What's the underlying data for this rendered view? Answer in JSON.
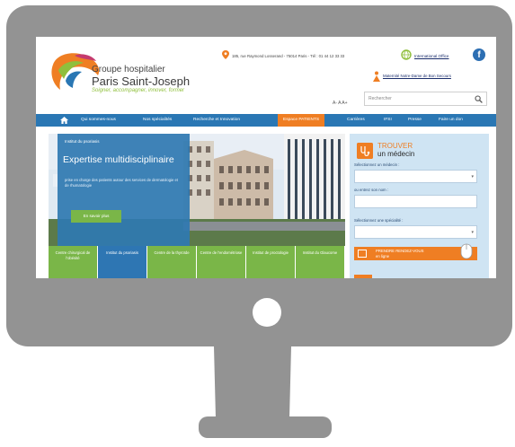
{
  "header": {
    "logo_line1": "Groupe hospitalier",
    "logo_line2": "Paris Saint-Joseph",
    "logo_tagline": "Soigner, accompagner, innover, former",
    "address": "185, rue Raymond Losserand - 75014 Paris - Tél : 01 44 12 33 33",
    "international_link": "International Office",
    "maternite_link": "Maternité Notre-Dame de Bon Secours",
    "font_size_controls": "A- A A+",
    "search_placeholder": "Rechercher"
  },
  "nav": {
    "items": [
      "Qui sommes-nous",
      "Nos spécialités",
      "Recherche et Innovation",
      "Espace PATIENTS",
      "Carrières",
      "IFSI",
      "Presse",
      "Faire un don"
    ],
    "active_index": 3
  },
  "hero": {
    "kicker": "Institut du psoriasis",
    "title": "Expertise multidisciplinaire",
    "text": "prise en charge des patients autour des services de dermatologie et de rhumatologie",
    "button": "En savoir plus"
  },
  "institutes": [
    "Centre chirurgical de l'obésité",
    "Institut du psoriasis",
    "Centre de la thyroïde",
    "Centre de l'endométriose",
    "Institut de proctologie",
    "Institut du Glaucome"
  ],
  "selected_institute": 1,
  "finder": {
    "title_line1": "TROUVER",
    "title_line2": "un médecin",
    "label_doctor": "Sélectionnez un médecin :",
    "label_name": "ou entrez son nom :",
    "label_specialty": "Sélectionnez une spécialité :",
    "rdv_line1": "PRENDRE RENDEZ-VOUS",
    "rdv_line2": "en ligne"
  },
  "colors": {
    "frame": "#939393",
    "nav_blue": "#2a77b4",
    "orange": "#ef7e23",
    "green": "#7ab648",
    "side_panel": "#cfe4f3"
  }
}
